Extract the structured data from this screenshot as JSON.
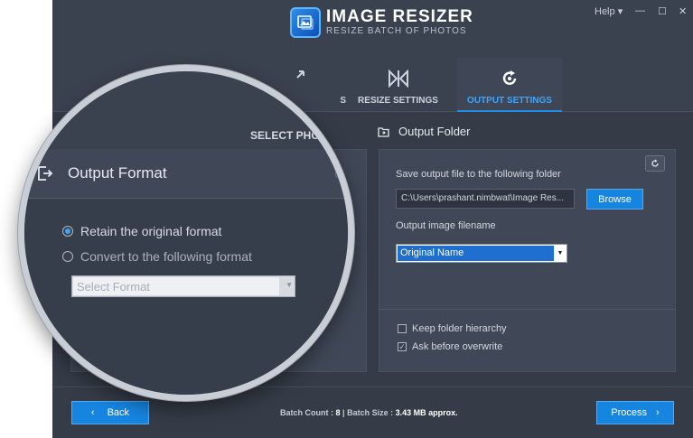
{
  "app": {
    "title": "IMAGE RESIZER",
    "subtitle": "RESIZE BATCH OF PHOTOS",
    "help_label": "Help",
    "help_arrow": "▾",
    "minimize": "—",
    "maximize": "☐",
    "close": "✕"
  },
  "tabs": [
    {
      "label": "SELECT PHOTOS",
      "icon": "arrows-expand-icon",
      "zoom_label": "SELECT PHOT",
      "small_label": "S"
    },
    {
      "label": "RESIZE SETTINGS",
      "icon": "resize-icon"
    },
    {
      "label": "OUTPUT SETTINGS",
      "icon": "refresh-icon",
      "active": true
    }
  ],
  "output_format": {
    "title": "Output Format",
    "options": [
      {
        "label": "Retain the original format",
        "selected": true
      },
      {
        "label": "Convert to the following format",
        "selected": false
      }
    ],
    "select_placeholder": "Select Format"
  },
  "output_folder": {
    "title": "Output Folder",
    "save_label": "Save output file to the following folder",
    "path_value": "C:\\Users\\prashant.nimbwat\\Image Res...",
    "browse_label": "Browse",
    "filename_label": "Output image filename",
    "filename_value": "Original Name",
    "checkboxes": [
      {
        "label": "Keep folder hierarchy",
        "checked": false
      },
      {
        "label": "Ask before overwrite",
        "checked": true
      }
    ]
  },
  "footer": {
    "back_label": "Back",
    "process_label": "Process",
    "batch_count_label": "Batch Count :",
    "batch_count_value": "8",
    "separator": "|",
    "batch_size_label": "Batch Size :",
    "batch_size_value": "3.43 MB approx."
  },
  "colors": {
    "accent": "#1585e0",
    "background": "#353c48",
    "active_tab_text": "#3aa6ff"
  }
}
